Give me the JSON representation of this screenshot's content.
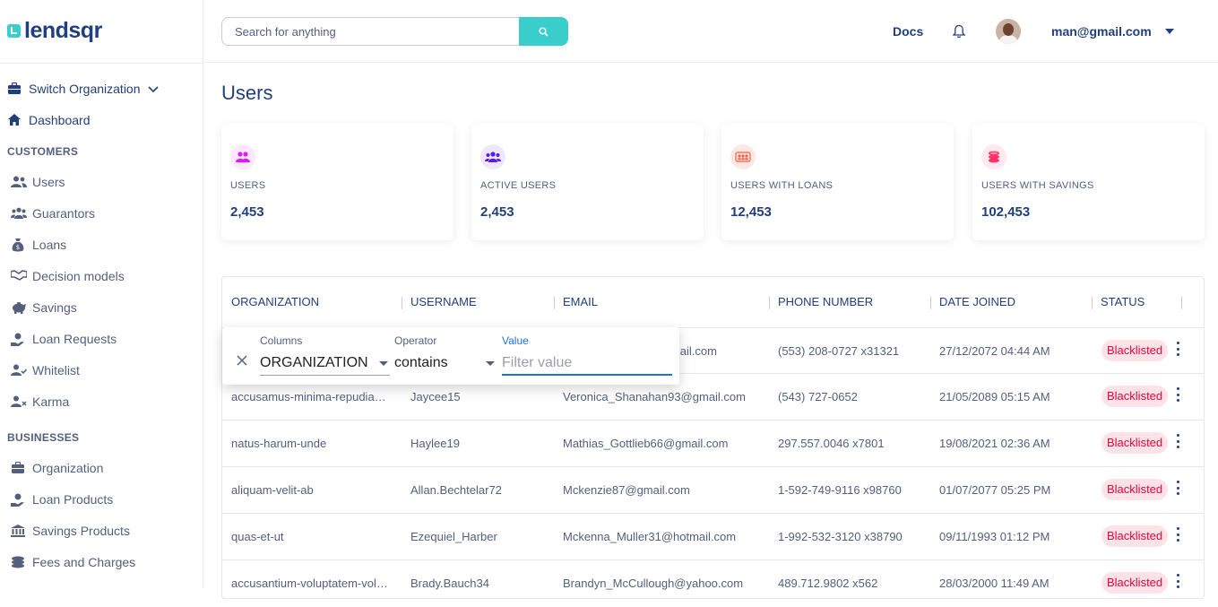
{
  "brand": {
    "name": "lendsqr"
  },
  "sidebar": {
    "switch_org": "Switch Organization",
    "dashboard": "Dashboard",
    "customers_title": "CUSTOMERS",
    "customers": [
      {
        "label": "Users",
        "icon": "users-icon"
      },
      {
        "label": "Guarantors",
        "icon": "guarantors-icon"
      },
      {
        "label": "Loans",
        "icon": "loan-bag-icon"
      },
      {
        "label": "Decision models",
        "icon": "handshake-icon"
      },
      {
        "label": "Savings",
        "icon": "piggy-bank-icon"
      },
      {
        "label": "Loan Requests",
        "icon": "loan-request-icon"
      },
      {
        "label": "Whitelist",
        "icon": "user-check-icon"
      },
      {
        "label": "Karma",
        "icon": "user-times-icon"
      }
    ],
    "businesses_title": "BUSINESSES",
    "businesses": [
      {
        "label": "Organization",
        "icon": "briefcase-icon"
      },
      {
        "label": "Loan Products",
        "icon": "loan-request-icon"
      },
      {
        "label": "Savings Products",
        "icon": "bank-icon"
      },
      {
        "label": "Fees and Charges",
        "icon": "coins-icon"
      }
    ]
  },
  "topbar": {
    "search_placeholder": "Search for anything",
    "docs": "Docs",
    "user_email": "man@gmail.com"
  },
  "page": {
    "title": "Users"
  },
  "cards": [
    {
      "label": "USERS",
      "value": "2,453",
      "color": "#DF18FF"
    },
    {
      "label": "ACTIVE USERS",
      "value": "2,453",
      "color": "#5718FF"
    },
    {
      "label": "USERS WITH LOANS",
      "value": "12,453",
      "color": "#F55F44"
    },
    {
      "label": "USERS WITH SAVINGS",
      "value": "102,453",
      "color": "#FF3366"
    }
  ],
  "table": {
    "headers": [
      "ORGANIZATION",
      "USERNAME",
      "EMAIL",
      "PHONE NUMBER",
      "DATE JOINED",
      "STATUS"
    ],
    "rows": [
      {
        "org": "",
        "username": "",
        "email": "nail.com",
        "phone": "(553) 208-0727 x31321",
        "date": "27/12/2072 04:44 AM",
        "status": "Blacklisted"
      },
      {
        "org": "accusamus-minima-repudia…",
        "username": "Jaycee15",
        "email": "Veronica_Shanahan93@gmail.com",
        "phone": "(543) 727-0652",
        "date": "21/05/2089 05:15 AM",
        "status": "Blacklisted"
      },
      {
        "org": "natus-harum-unde",
        "username": "Haylee19",
        "email": "Mathias_Gottlieb66@gmail.com",
        "phone": "297.557.0046 x7801",
        "date": "19/08/2021 02:36 AM",
        "status": "Blacklisted"
      },
      {
        "org": "aliquam-velit-ab",
        "username": "Allan.Bechtelar72",
        "email": "Mckenzie87@gmail.com",
        "phone": "1-592-749-9116 x98760",
        "date": "01/07/2077 05:25 PM",
        "status": "Blacklisted"
      },
      {
        "org": "quas-et-ut",
        "username": "Ezequiel_Harber",
        "email": "Mckenna_Muller31@hotmail.com",
        "phone": "1-992-532-3120 x38790",
        "date": "09/11/1993 01:12 PM",
        "status": "Blacklisted"
      },
      {
        "org": "accusantium-voluptatem-vol…",
        "username": "Brady.Bauch34",
        "email": "Brandyn_McCullough@yahoo.com",
        "phone": "489.712.9802 x562",
        "date": "28/03/2000 11:49 AM",
        "status": "Blacklisted"
      }
    ]
  },
  "filter": {
    "columns_label": "Columns",
    "columns_value": "ORGANIZATION",
    "operator_label": "Operator",
    "operator_value": "contains",
    "value_label": "Value",
    "value_placeholder": "Filter value"
  }
}
